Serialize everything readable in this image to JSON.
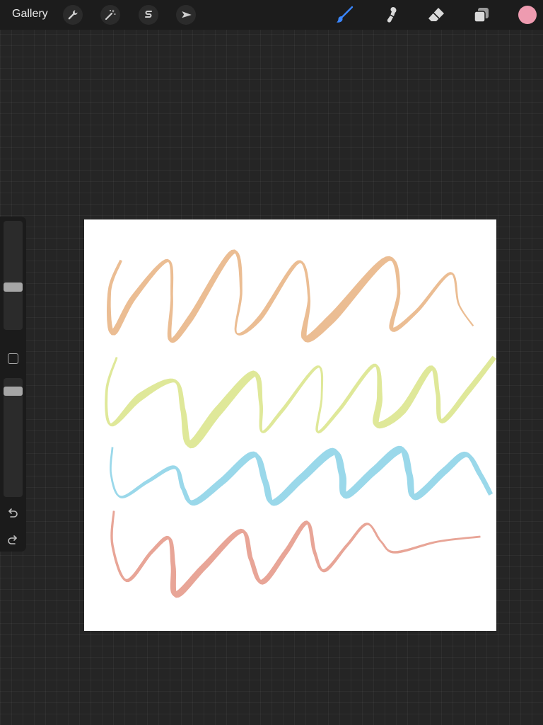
{
  "toolbar": {
    "gallery_label": "Gallery",
    "left_tools": [
      {
        "name": "actions",
        "icon": "wrench-icon"
      },
      {
        "name": "adjustments",
        "icon": "magic-wand-icon"
      },
      {
        "name": "selection",
        "icon": "selection-s-icon"
      },
      {
        "name": "transform",
        "icon": "arrow-cursor-icon"
      }
    ],
    "right_tools": [
      {
        "name": "brush",
        "icon": "brush-icon",
        "active": true
      },
      {
        "name": "smudge",
        "icon": "smudge-icon"
      },
      {
        "name": "eraser",
        "icon": "eraser-icon"
      },
      {
        "name": "layers",
        "icon": "layers-icon"
      }
    ],
    "active_tool_color": "#3a86ff",
    "current_color": "#ee9bb0"
  },
  "sidebar": {
    "brush_size_level": 0.62,
    "opacity_level": 0.08,
    "modify_button": "square-icon",
    "undo": "undo-icon",
    "redo": "redo-icon"
  },
  "canvas": {
    "background": "#ffffff",
    "strokes": [
      {
        "row": 1,
        "color": "#ebbd93"
      },
      {
        "row": 2,
        "color": "#dfe899"
      },
      {
        "row": 3,
        "color": "#9ad8ea"
      },
      {
        "row": 4,
        "color": "#e8a597"
      }
    ]
  }
}
